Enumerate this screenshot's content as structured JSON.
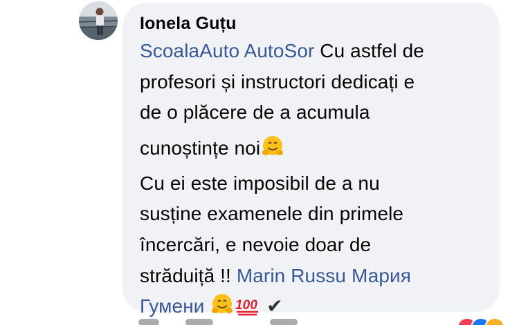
{
  "comment": {
    "author": "Ionela Guțu",
    "mention_school": "ScoalaAuto AutoSor",
    "lines": {
      "l1_rest": " Cu astfel de",
      "l2": "profesori și instructori dedicați e",
      "l3": "de o plăcere de a acumula",
      "l4": "cunoștințe noi",
      "l5": "Cu ei este  imposibil de a nu",
      "l6": "susține examenele din primele",
      "l7": "încercări, e nevoie doar de",
      "l8": "străduiță !! "
    },
    "mention_person_a": "Marin Russu",
    "mention_person_b_part1": "Мария",
    "mention_person_b_part2": "Гумени",
    "emoji_names": [
      "hugging-face-emoji",
      "hundred-points-emoji",
      "check-mark-emoji"
    ],
    "check_mark": "✔"
  },
  "colors": {
    "bubble": "#f0f2f5",
    "text": "#050505",
    "mention": "#385898",
    "meta": "#65676b"
  }
}
